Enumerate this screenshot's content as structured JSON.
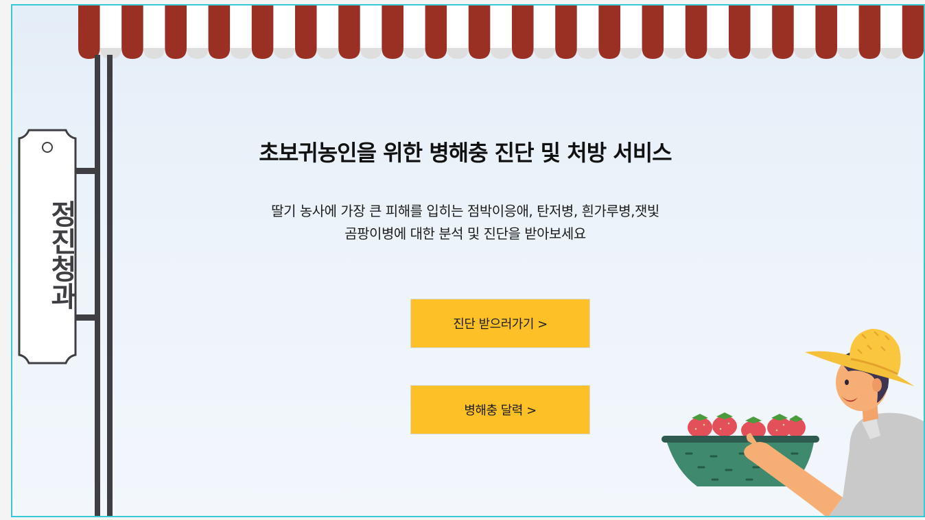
{
  "sign": {
    "label": "정진청과"
  },
  "hero": {
    "title": "초보귀농인을 위한 병해충 진단 및 처방 서비스",
    "description_line1": "딸기 농사에 가장 큰 피해를 입히는 점박이응애, 탄저병, 흰가루병,잿빛",
    "description_line2": "곰팡이병에 대한 분석 및 진단을 받아보세요"
  },
  "buttons": {
    "diagnosis_label": "진단 받으러가기  >",
    "calendar_label": "병해충 달력  >"
  },
  "colors": {
    "awning_red": "#9a3023",
    "awning_white": "#ffffff",
    "button_yellow": "#fdc027",
    "frame_border": "#35c9d6",
    "pole": "#3f3e43"
  },
  "icons": {
    "awning": "striped-awning",
    "sign": "hanging-shop-sign",
    "illustration": "farmer-with-strawberry-basket"
  }
}
